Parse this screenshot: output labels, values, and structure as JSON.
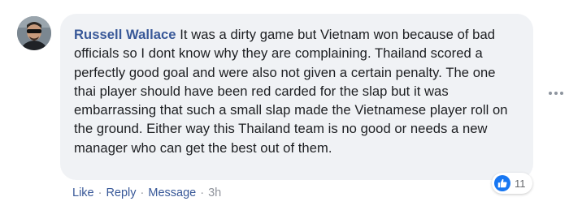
{
  "comment": {
    "author": "Russell Wallace",
    "text": "It was a dirty game but Vietnam won because of bad officials so I dont know why they are complaining. Thailand scored a perfectly good goal and were also not given a certain penalty. The one thai player should have been red carded for the slap but it was embarrassing that such a small slap made the Vietnamese player roll on the ground. Either way this Thailand team is no good or needs a new manager who can get the best out of them.",
    "reactions": {
      "icon": "like-icon",
      "count": "11"
    },
    "actions": {
      "like": "Like",
      "reply": "Reply",
      "message": "Message",
      "separator": "·",
      "timestamp": "3h"
    },
    "more_icon": "more-options-icon"
  },
  "colors": {
    "bubble": "#f0f2f5",
    "author": "#385898",
    "link": "#385898",
    "like_blue": "#1877f2",
    "meta_gray": "#90949c"
  }
}
